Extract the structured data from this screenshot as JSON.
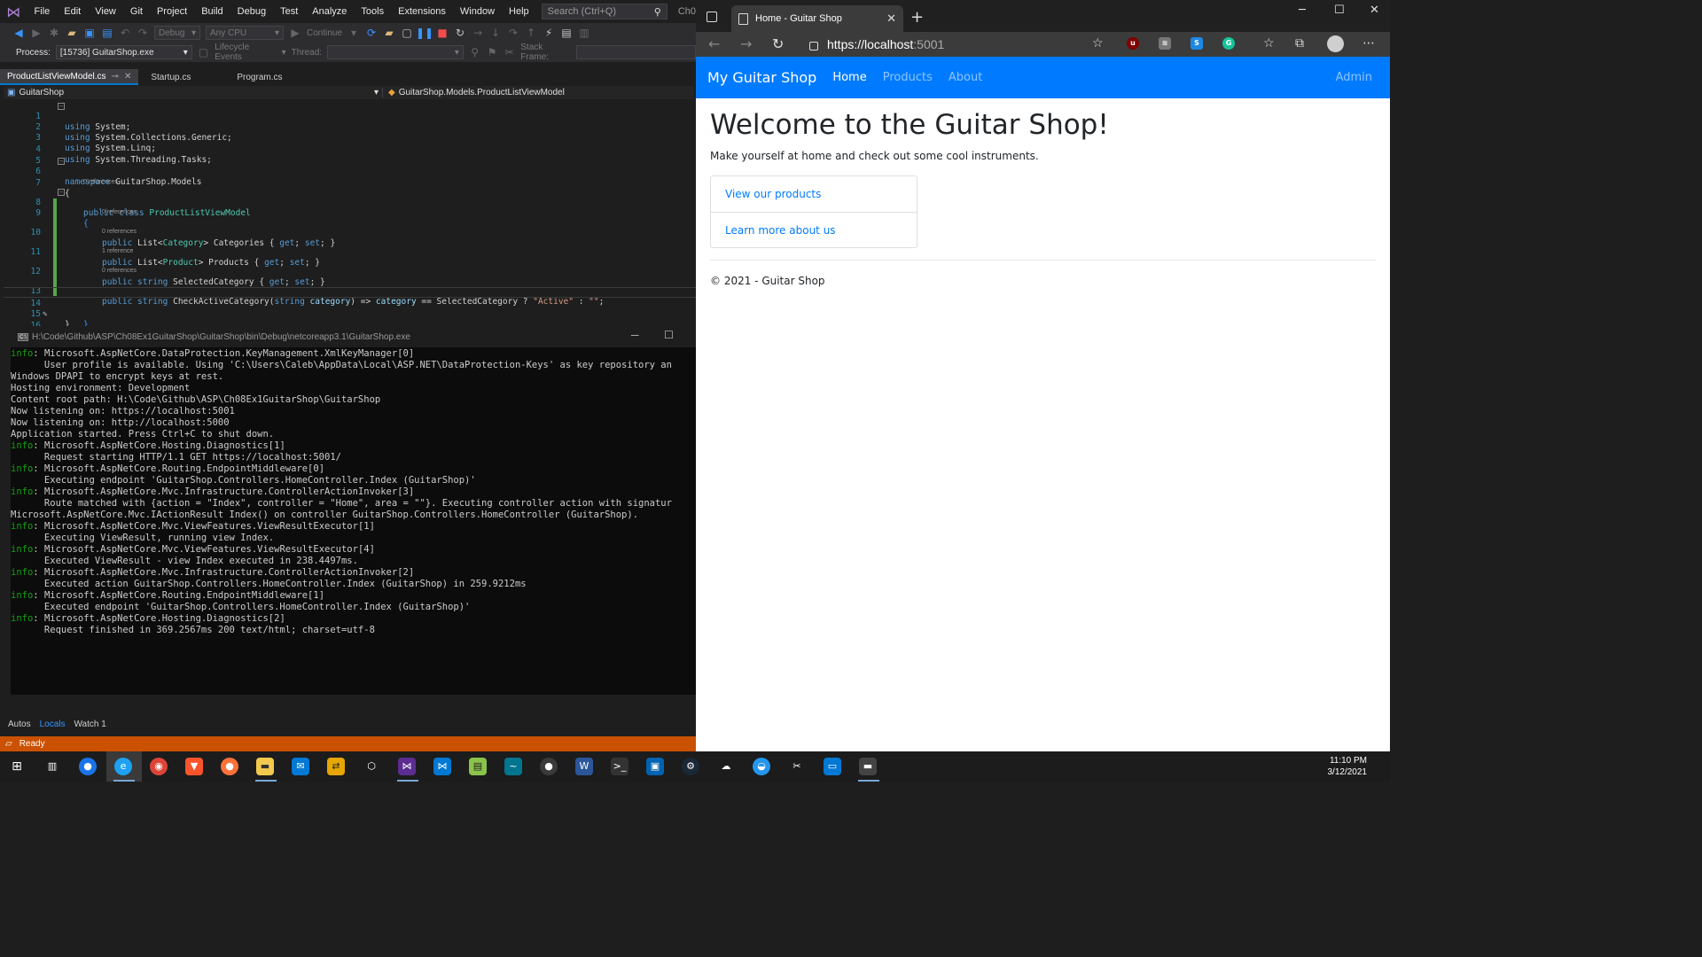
{
  "vs": {
    "menu": [
      "File",
      "Edit",
      "View",
      "Git",
      "Project",
      "Build",
      "Debug",
      "Test",
      "Analyze",
      "Tools",
      "Extensions",
      "Window",
      "Help"
    ],
    "search_placeholder": "Search (Ctrl+Q)",
    "title_short": "Ch0",
    "toolbar": {
      "config": "Debug",
      "platform": "Any CPU",
      "continue": "Continue"
    },
    "toolbar2": {
      "process_label": "Process:",
      "process_value": "[15736] GuitarShop.exe",
      "lifecycle": "Lifecycle Events",
      "thread_label": "Thread:",
      "stack_label": "Stack Frame:"
    },
    "tabs": [
      {
        "label": "ProductListViewModel.cs",
        "active": true
      },
      {
        "label": "Startup.cs",
        "active": false
      },
      {
        "label": "Program.cs",
        "active": false
      }
    ],
    "nav": {
      "project": "GuitarShop",
      "member": "GuitarShop.Models.ProductListViewModel"
    },
    "code": {
      "line_numbers": [
        "1",
        "2",
        "3",
        "4",
        "5",
        "6",
        "7",
        "8",
        "9",
        "10",
        "11",
        "12",
        "13",
        "14",
        "15",
        "16"
      ],
      "codelens": {
        "class_refs": "0 references",
        "categories_refs": "0 references",
        "products_refs": "0 references",
        "selected_refs": "1 reference",
        "check_refs": "0 references"
      },
      "l1_kw": "using",
      "l1_rest": " System;",
      "l2_kw": "using",
      "l2_rest": " System.Collections.Generic;",
      "l3_kw": "using",
      "l3_rest": " System.Linq;",
      "l4_kw": "using",
      "l4_rest": " System.Threading.Tasks;",
      "l6_kw": "namespace",
      "l6_rest": " GuitarShop.Models",
      "l7": "{",
      "l8_kw1": "public",
      "l8_kw2": " class",
      "l8_type": " ProductListViewModel",
      "l9": "{",
      "l10_kw": "public",
      "l10_a": " List<",
      "l10_t": "Category",
      "l10_b": "> Categories { ",
      "l10_get": "get",
      "l10_c": "; ",
      "l10_set": "set",
      "l10_d": "; }",
      "l11_kw": "public",
      "l11_a": " List<",
      "l11_t": "Product",
      "l11_b": "> Products { ",
      "l11_get": "get",
      "l11_c": "; ",
      "l11_set": "set",
      "l11_d": "; }",
      "l12_kw": "public",
      "l12_kw2": " string",
      "l12_a": " SelectedCategory { ",
      "l12_get": "get",
      "l12_c": "; ",
      "l12_set": "set",
      "l12_d": "; }",
      "l13_kw": "public",
      "l13_kw2": " string",
      "l13_a": " CheckActiveCategory(",
      "l13_kw3": "string",
      "l13_p": " category",
      "l13_b": ") => ",
      "l13_p2": "category",
      "l13_c": " == SelectedCategory ? ",
      "l13_s1": "\"Active\"",
      "l13_d": " : ",
      "l13_s2": "\"\"",
      "l13_e": ";",
      "l14": "}",
      "l15": "}"
    },
    "console": {
      "title": "H:\\Code\\Github\\ASP\\Ch08Ex1GuitarShop\\GuitarShop\\bin\\Debug\\netcoreapp3.1\\GuitarShop.exe",
      "lines": [
        {
          "tag": "info",
          "text": ": Microsoft.AspNetCore.DataProtection.KeyManagement.XmlKeyManager[0]"
        },
        {
          "tag": "",
          "text": "      User profile is available. Using 'C:\\Users\\Caleb\\AppData\\Local\\ASP.NET\\DataProtection-Keys' as key repository an"
        },
        {
          "tag": "",
          "text": "Windows DPAPI to encrypt keys at rest."
        },
        {
          "tag": "",
          "text": "Hosting environment: Development"
        },
        {
          "tag": "",
          "text": "Content root path: H:\\Code\\Github\\ASP\\Ch08Ex1GuitarShop\\GuitarShop"
        },
        {
          "tag": "",
          "text": "Now listening on: https://localhost:5001"
        },
        {
          "tag": "",
          "text": "Now listening on: http://localhost:5000"
        },
        {
          "tag": "",
          "text": "Application started. Press Ctrl+C to shut down."
        },
        {
          "tag": "info",
          "text": ": Microsoft.AspNetCore.Hosting.Diagnostics[1]"
        },
        {
          "tag": "",
          "text": "      Request starting HTTP/1.1 GET https://localhost:5001/"
        },
        {
          "tag": "info",
          "text": ": Microsoft.AspNetCore.Routing.EndpointMiddleware[0]"
        },
        {
          "tag": "",
          "text": "      Executing endpoint 'GuitarShop.Controllers.HomeController.Index (GuitarShop)'"
        },
        {
          "tag": "info",
          "text": ": Microsoft.AspNetCore.Mvc.Infrastructure.ControllerActionInvoker[3]"
        },
        {
          "tag": "",
          "text": "      Route matched with {action = \"Index\", controller = \"Home\", area = \"\"}. Executing controller action with signatur"
        },
        {
          "tag": "",
          "text": "Microsoft.AspNetCore.Mvc.IActionResult Index() on controller GuitarShop.Controllers.HomeController (GuitarShop)."
        },
        {
          "tag": "info",
          "text": ": Microsoft.AspNetCore.Mvc.ViewFeatures.ViewResultExecutor[1]"
        },
        {
          "tag": "",
          "text": "      Executing ViewResult, running view Index."
        },
        {
          "tag": "info",
          "text": ": Microsoft.AspNetCore.Mvc.ViewFeatures.ViewResultExecutor[4]"
        },
        {
          "tag": "",
          "text": "      Executed ViewResult - view Index executed in 238.4497ms."
        },
        {
          "tag": "info",
          "text": ": Microsoft.AspNetCore.Mvc.Infrastructure.ControllerActionInvoker[2]"
        },
        {
          "tag": "",
          "text": "      Executed action GuitarShop.Controllers.HomeController.Index (GuitarShop) in 259.9212ms"
        },
        {
          "tag": "info",
          "text": ": Microsoft.AspNetCore.Routing.EndpointMiddleware[1]"
        },
        {
          "tag": "",
          "text": "      Executed endpoint 'GuitarShop.Controllers.HomeController.Index (GuitarShop)'"
        },
        {
          "tag": "info",
          "text": ": Microsoft.AspNetCore.Hosting.Diagnostics[2]"
        },
        {
          "tag": "",
          "text": "      Request finished in 369.2567ms 200 text/html; charset=utf-8"
        }
      ]
    },
    "bottom_tabs": [
      {
        "label": "Autos",
        "active": false
      },
      {
        "label": "Locals",
        "active": true
      },
      {
        "label": "Watch 1",
        "active": false
      }
    ],
    "status": "Ready"
  },
  "browser": {
    "tab_title": "Home - Guitar Shop",
    "url_host": "https://localhost",
    "url_port": ":5001",
    "site": {
      "brand": "My Guitar Shop",
      "nav": [
        {
          "label": "Home",
          "active": true
        },
        {
          "label": "Products",
          "active": false
        },
        {
          "label": "About",
          "active": false
        }
      ],
      "admin": "Admin",
      "heading": "Welcome to the Guitar Shop!",
      "lead": "Make yourself at home and check out some cool instruments.",
      "links": [
        "View our products",
        "Learn more about us"
      ],
      "footer": "© 2021 - Guitar Shop"
    }
  },
  "taskbar": {
    "time": "11:10 PM",
    "date": "3/12/2021"
  },
  "colors": {
    "vs_status": "#ca5100",
    "site_nav": "#007bff",
    "console_info": "#13a10e"
  }
}
